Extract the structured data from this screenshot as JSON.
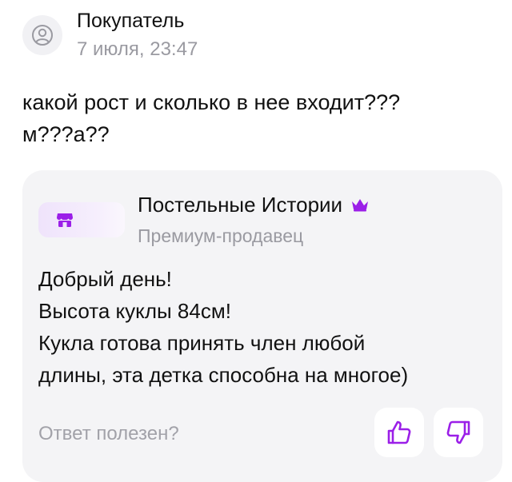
{
  "review": {
    "author_name": "Покупатель",
    "date": "7 июля, 23:47",
    "question_lines": [
      "какой рост и сколько в нее входит???",
      "м???а??"
    ]
  },
  "answer": {
    "seller_name": "Постельные Истории",
    "seller_badge": "Премиум-продавец",
    "text_lines": [
      "Добрый день!",
      "Высота куклы 84см!",
      "Кукла готова принять член любой",
      "длины, эта детка способна на многое)"
    ],
    "helpful_prompt": "Ответ полезен?"
  },
  "colors": {
    "accent": "#9b1fe8",
    "muted_text": "#9a9aa1",
    "card_background": "#f4f4f6"
  },
  "icons": {
    "avatar": "user-circle-icon",
    "seller_logo": "shop-icon",
    "premium": "crown-icon",
    "like": "thumbs-up-icon",
    "dislike": "thumbs-down-icon"
  }
}
